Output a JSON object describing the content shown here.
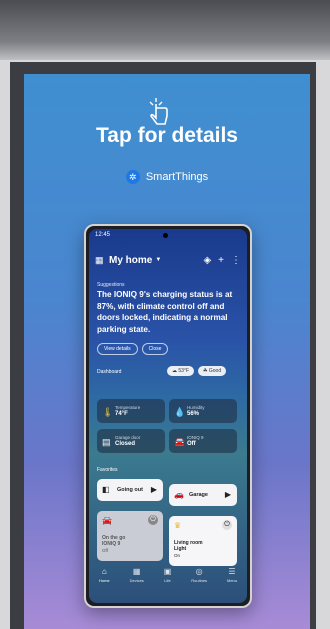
{
  "poster": {
    "headline": "Tap for details",
    "brand": "SmartThings",
    "icons": {
      "tap": "tap-hand-icon",
      "brand_logo": "smartthings-logo-icon"
    }
  },
  "phone": {
    "status_time": "12:45",
    "home_title": "My home",
    "suggestions_label": "Suggestions",
    "suggestion_text": "The IONIQ 9's charging status is at 87%, with climate control off and doors locked, indicating a normal parking state.",
    "view_details": "View details",
    "close": "Close",
    "dashboard_label": "Dashboard",
    "weather_temp": "53°F",
    "air_quality": "Good",
    "tiles": [
      {
        "label": "Temperature",
        "value": "74°F",
        "icon": "thermometer-icon"
      },
      {
        "label": "Humidity",
        "value": "56%",
        "icon": "droplet-icon"
      },
      {
        "label": "Garage door",
        "value": "Closed",
        "icon": "garage-icon"
      },
      {
        "label": "IONIQ 9",
        "value": "Off",
        "icon": "car-icon"
      }
    ],
    "favorites_label": "Favorites",
    "favorites": [
      {
        "label": "Going out",
        "icon": "going-out-icon"
      },
      {
        "label": "Garage",
        "icon": "garage-car-icon"
      }
    ],
    "devices": [
      {
        "line1": "On the go",
        "line2": "IONIQ 9",
        "line3": "Off",
        "icon": "car-icon"
      },
      {
        "line1": "Living room",
        "line2": "Light",
        "line3": "On",
        "icon": "lamp-icon"
      }
    ],
    "nav": [
      "Home",
      "Devices",
      "Life",
      "Routines",
      "Menu"
    ]
  }
}
